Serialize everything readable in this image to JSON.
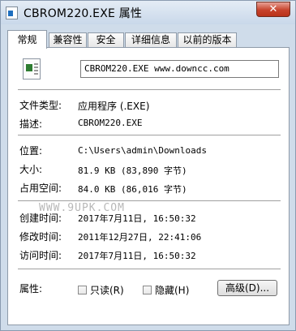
{
  "window": {
    "title": "CBROM220.EXE 属性",
    "close_glyph": "✕"
  },
  "tabs": [
    {
      "label": "常规",
      "active": true
    },
    {
      "label": "兼容性",
      "active": false
    },
    {
      "label": "安全",
      "active": false
    },
    {
      "label": "详细信息",
      "active": false
    },
    {
      "label": "以前的版本",
      "active": false
    }
  ],
  "general": {
    "file_name": "CBROM220.EXE  www.downcc.com",
    "file_type_label": "文件类型:",
    "file_type_value": "应用程序 (.EXE)",
    "description_label": "描述:",
    "description_value": "CBROM220.EXE",
    "location_label": "位置:",
    "location_value": "C:\\Users\\admin\\Downloads",
    "size_label": "大小:",
    "size_value": "81.9 KB (83,890 字节)",
    "size_on_disk_label": "占用空间:",
    "size_on_disk_value": "84.0 KB (86,016 字节)",
    "created_label": "创建时间:",
    "created_value": "2017年7月11日, 16:50:32",
    "modified_label": "修改时间:",
    "modified_value": "2011年12月27日, 22:41:06",
    "accessed_label": "访问时间:",
    "accessed_value": "2017年7月11日, 16:50:32",
    "attributes_label": "属性:",
    "readonly_label": "只读(R)",
    "hidden_label": "隐藏(H)",
    "advanced_button": "高级(D)..."
  },
  "watermark": "WWW.9UPK.COM",
  "colors": {
    "close_button": "#c7432c",
    "titlebar": "#c9d8ea"
  }
}
